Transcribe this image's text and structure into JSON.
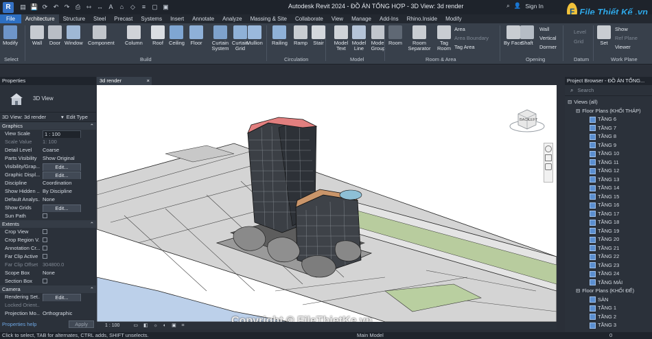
{
  "titlebar": {
    "app_icon": "R",
    "title": "Autodesk Revit 2024 - ĐỒ ÁN TỔNG HỢP - 3D View: 3d render",
    "sign_in": "Sign In",
    "logo_text": "File Thiết Kế .vn",
    "qat_icons": [
      "open-icon",
      "save-icon",
      "sync-icon",
      "undo-icon",
      "redo-icon",
      "print-icon",
      "measure-icon",
      "dimension-icon",
      "text-icon",
      "view3d-icon",
      "section-icon",
      "thinlines-icon",
      "close-hidden-icon",
      "switch-windows-icon"
    ]
  },
  "tabs": [
    "File",
    "Architecture",
    "Structure",
    "Steel",
    "Precast",
    "Systems",
    "Insert",
    "Annotate",
    "Analyze",
    "Massing & Site",
    "Collaborate",
    "View",
    "Manage",
    "Add-Ins",
    "Rhino.Inside",
    "Modify"
  ],
  "active_tab": "Architecture",
  "ribbon": {
    "buttons": [
      {
        "label": "Modify",
        "color": "#6e95c9"
      },
      {
        "label": "Wall",
        "color": "#c7cbd1"
      },
      {
        "label": "Door",
        "color": "#b9bec6"
      },
      {
        "label": "Window",
        "color": "#9fb8d6"
      },
      {
        "label": "Component",
        "color": "#c2c6cc"
      },
      {
        "label": "Column",
        "color": "#d0d3d8"
      },
      {
        "label": "Roof",
        "color": "#d9dde2"
      },
      {
        "label": "Ceiling",
        "color": "#7fa6d3"
      },
      {
        "label": "Floor",
        "color": "#8eb0d8"
      },
      {
        "label": "Curtain System",
        "color": "#7ea2cc"
      },
      {
        "label": "Curtain Grid",
        "color": "#8fb1d7"
      },
      {
        "label": "Mullion",
        "color": "#9bb9dc"
      },
      {
        "label": "Railing",
        "color": "#8fb1d7"
      },
      {
        "label": "Ramp",
        "color": "#c9cdd2"
      },
      {
        "label": "Stair",
        "color": "#d4d8dd"
      },
      {
        "label": "Model Text",
        "color": "#cfd3d8"
      },
      {
        "label": "Model Line",
        "color": "#b5c4d8"
      },
      {
        "label": "Model Group",
        "color": "#c1c6cd"
      },
      {
        "label": "Room",
        "color": "#5f6874"
      },
      {
        "label": "Room Separator",
        "color": "#c9cdd2"
      },
      {
        "label": "Tag Room",
        "color": "#c9cdd2"
      },
      {
        "label": "By Face",
        "color": "#c9cdd2"
      },
      {
        "label": "Shaft",
        "color": "#b5bcc5"
      },
      {
        "label": "Set",
        "color": "#c9cdd2"
      }
    ],
    "small_buttons": {
      "area": "Area",
      "area_boundary": "Area Boundary",
      "tag_area": "Tag Area",
      "wall": "Wall",
      "vertical": "Vertical",
      "dormer": "Dormer",
      "level": "Level",
      "grid": "Grid",
      "show": "Show",
      "ref_plane": "Ref Plane",
      "viewer": "Viewer"
    },
    "groups": [
      "Select",
      "Build",
      "Circulation",
      "Model",
      "Room & Area",
      "Opening",
      "Datum",
      "Work Plane"
    ]
  },
  "properties": {
    "title": "Properties",
    "type_name": "3D View",
    "selector": "3D View: 3d render",
    "edit_type": "Edit Type",
    "sections": {
      "graphics": "Graphics",
      "extents": "Extents",
      "camera": "Camera"
    },
    "graphics_rows": [
      {
        "k": "View Scale",
        "v": "1 : 100",
        "kind": "box"
      },
      {
        "k": "Scale Value",
        "v": "1:  100",
        "kind": "dim"
      },
      {
        "k": "Detail Level",
        "v": "Coarse",
        "kind": "text"
      },
      {
        "k": "Parts Visibility",
        "v": "Show Original",
        "kind": "text"
      },
      {
        "k": "Visibility/Grap...",
        "v": "Edit...",
        "kind": "btn"
      },
      {
        "k": "Graphic Displ...",
        "v": "Edit...",
        "kind": "btn"
      },
      {
        "k": "Discipline",
        "v": "Coordination",
        "kind": "text"
      },
      {
        "k": "Show Hidden ...",
        "v": "By Discipline",
        "kind": "text"
      },
      {
        "k": "Default Analys...",
        "v": "None",
        "kind": "text"
      },
      {
        "k": "Show Grids",
        "v": "Edit...",
        "kind": "btn"
      },
      {
        "k": "Sun Path",
        "v": "",
        "kind": "check"
      }
    ],
    "extents_rows": [
      {
        "k": "Crop View",
        "v": "",
        "kind": "check"
      },
      {
        "k": "Crop Region V...",
        "v": "",
        "kind": "check"
      },
      {
        "k": "Annotation Cr...",
        "v": "",
        "kind": "check"
      },
      {
        "k": "Far Clip Active",
        "v": "",
        "kind": "check"
      },
      {
        "k": "Far Clip Offset",
        "v": "304800.0",
        "kind": "dim"
      },
      {
        "k": "Scope Box",
        "v": "None",
        "kind": "text"
      },
      {
        "k": "Section Box",
        "v": "",
        "kind": "check"
      }
    ],
    "camera_rows": [
      {
        "k": "Rendering Set...",
        "v": "Edit...",
        "kind": "btn"
      },
      {
        "k": "Locked Orient...",
        "v": "",
        "kind": "dim"
      },
      {
        "k": "Projection Mo...",
        "v": "Orthographic",
        "kind": "text"
      }
    ],
    "help": "Properties help",
    "apply": "Apply"
  },
  "view": {
    "tab_label": "3d render",
    "scale": "1 : 100",
    "cube_left": "LEFT",
    "cube_back": "BACK"
  },
  "project_browser": {
    "title": "Project Browser - ĐỒ ÁN TỔNG...",
    "search_placeholder": "Search",
    "views_all": "Views (all)",
    "group1": "Floor Plans (KHỐI THÁP)",
    "group1_items": [
      "TẦNG 6",
      "TẦNG 7",
      "TẦNG 8",
      "TẦNG 9",
      "TẦNG 10",
      "TẦNG 11",
      "TẦNG 12",
      "TẦNG 13",
      "TẦNG 14",
      "TẦNG 15",
      "TẦNG 16",
      "TẦNG 17",
      "TẦNG 18",
      "TẦNG 19",
      "TẦNG 20",
      "TẦNG 21",
      "TẦNG 22",
      "TẦNG 23",
      "TẦNG 24",
      "TẦNG MÁI"
    ],
    "group2": "Floor Plans (KHỐI ĐẾ)",
    "group2_items": [
      "SÀN",
      "TẦNG 1",
      "TẦNG 2",
      "TẦNG 3"
    ]
  },
  "status": {
    "message": "Click to select, TAB for alternates, CTRL adds, SHIFT unselects.",
    "model": "Main Model",
    "value": "0"
  },
  "watermark": "Copyright © FileThietKe.vn"
}
